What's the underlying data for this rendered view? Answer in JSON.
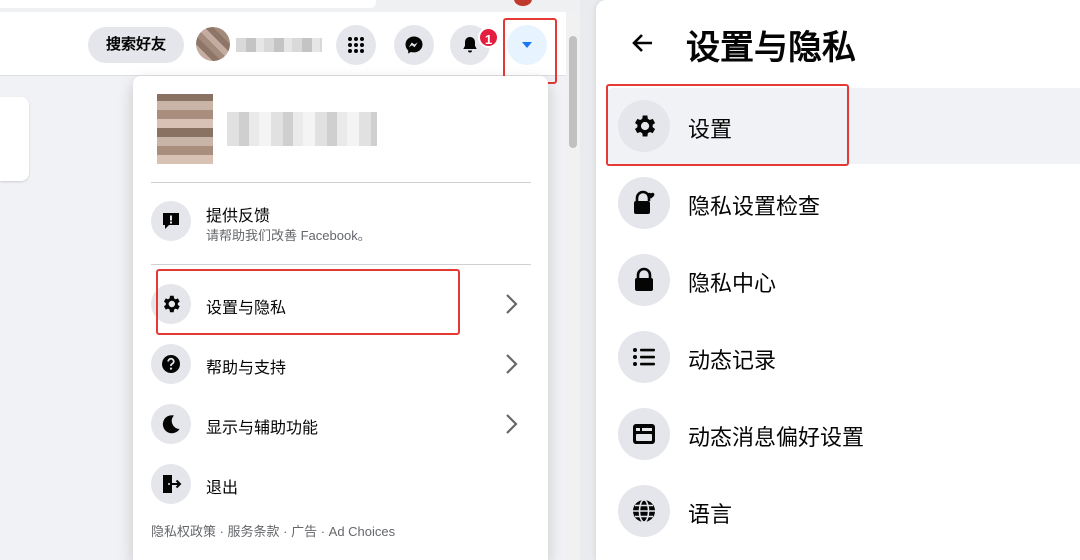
{
  "left_panel": {
    "search_button": "搜索好友",
    "notification_count": "1",
    "menu": {
      "feedback": {
        "title": "提供反馈",
        "subtitle": "请帮助我们改善 Facebook。"
      },
      "items": [
        {
          "label": "设置与隐私",
          "icon": "gear-icon",
          "has_chevron": true,
          "highlighted": true
        },
        {
          "label": "帮助与支持",
          "icon": "question-icon",
          "has_chevron": true
        },
        {
          "label": "显示与辅助功能",
          "icon": "moon-icon",
          "has_chevron": true
        },
        {
          "label": "退出",
          "icon": "logout-icon",
          "has_chevron": false
        }
      ],
      "footer": "隐私权政策 · 服务条款 · 广告 · Ad Choices"
    }
  },
  "right_panel": {
    "title": "设置与隐私",
    "items": [
      {
        "label": "设置",
        "icon": "gear-icon",
        "highlighted": true
      },
      {
        "label": "隐私设置检查",
        "icon": "lock-heart-icon"
      },
      {
        "label": "隐私中心",
        "icon": "lock-icon"
      },
      {
        "label": "动态记录",
        "icon": "list-icon"
      },
      {
        "label": "动态消息偏好设置",
        "icon": "news-feed-icon"
      },
      {
        "label": "语言",
        "icon": "globe-icon"
      }
    ]
  },
  "colors": {
    "highlight_box": "#e53935",
    "accent_blue": "#1877f2",
    "badge_red": "#e41e3f"
  }
}
